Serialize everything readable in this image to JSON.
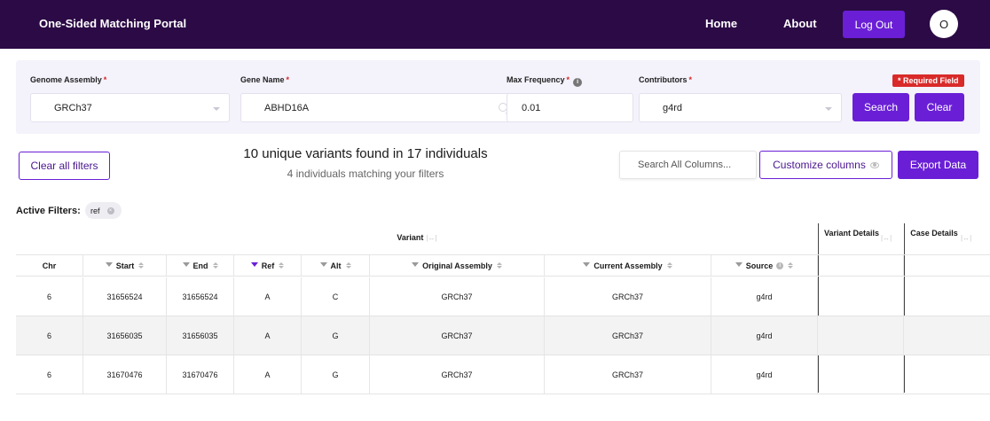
{
  "header": {
    "brand": "One-Sided Matching Portal",
    "nav": {
      "home": "Home",
      "about": "About"
    },
    "logout_label": "Log Out",
    "avatar_initial": "O"
  },
  "filters": {
    "genome_assembly": {
      "label": "Genome Assembly",
      "value": "GRCh37"
    },
    "gene_name": {
      "label": "Gene Name",
      "value": "ABHD16A"
    },
    "max_frequency": {
      "label": "Max Frequency",
      "value": "0.01"
    },
    "contributors": {
      "label": "Contributors",
      "value": "g4rd"
    },
    "required_badge": "* Required Field",
    "required_mark": "*",
    "search_label": "Search",
    "clear_label": "Clear"
  },
  "toolbar": {
    "clear_all_label": "Clear all filters",
    "summary_main": "10 unique variants found in 17 individuals",
    "summary_sub": "4 individuals matching your filters",
    "search_placeholder": "Search All Columns...",
    "customize_label": "Customize columns",
    "export_label": "Export Data"
  },
  "active_filters": {
    "label": "Active Filters:",
    "chips": [
      "ref"
    ]
  },
  "table": {
    "groups": {
      "variant": "Variant",
      "variant_details": "Variant Details",
      "case_details": "Case Details"
    },
    "columns": [
      "Chr",
      "Start",
      "End",
      "Ref",
      "Alt",
      "Original Assembly",
      "Current Assembly",
      "Source"
    ],
    "rows": [
      [
        "6",
        "31656524",
        "31656524",
        "A",
        "C",
        "GRCh37",
        "GRCh37",
        "g4rd"
      ],
      [
        "6",
        "31656035",
        "31656035",
        "A",
        "G",
        "GRCh37",
        "GRCh37",
        "g4rd"
      ],
      [
        "6",
        "31670476",
        "31670476",
        "A",
        "G",
        "GRCh37",
        "GRCh37",
        "g4rd"
      ]
    ]
  },
  "colors": {
    "header_bg": "#2b0a45",
    "accent": "#6a1fd6",
    "required_red": "#d92a2a",
    "panel_bg": "#f4f2fb"
  }
}
